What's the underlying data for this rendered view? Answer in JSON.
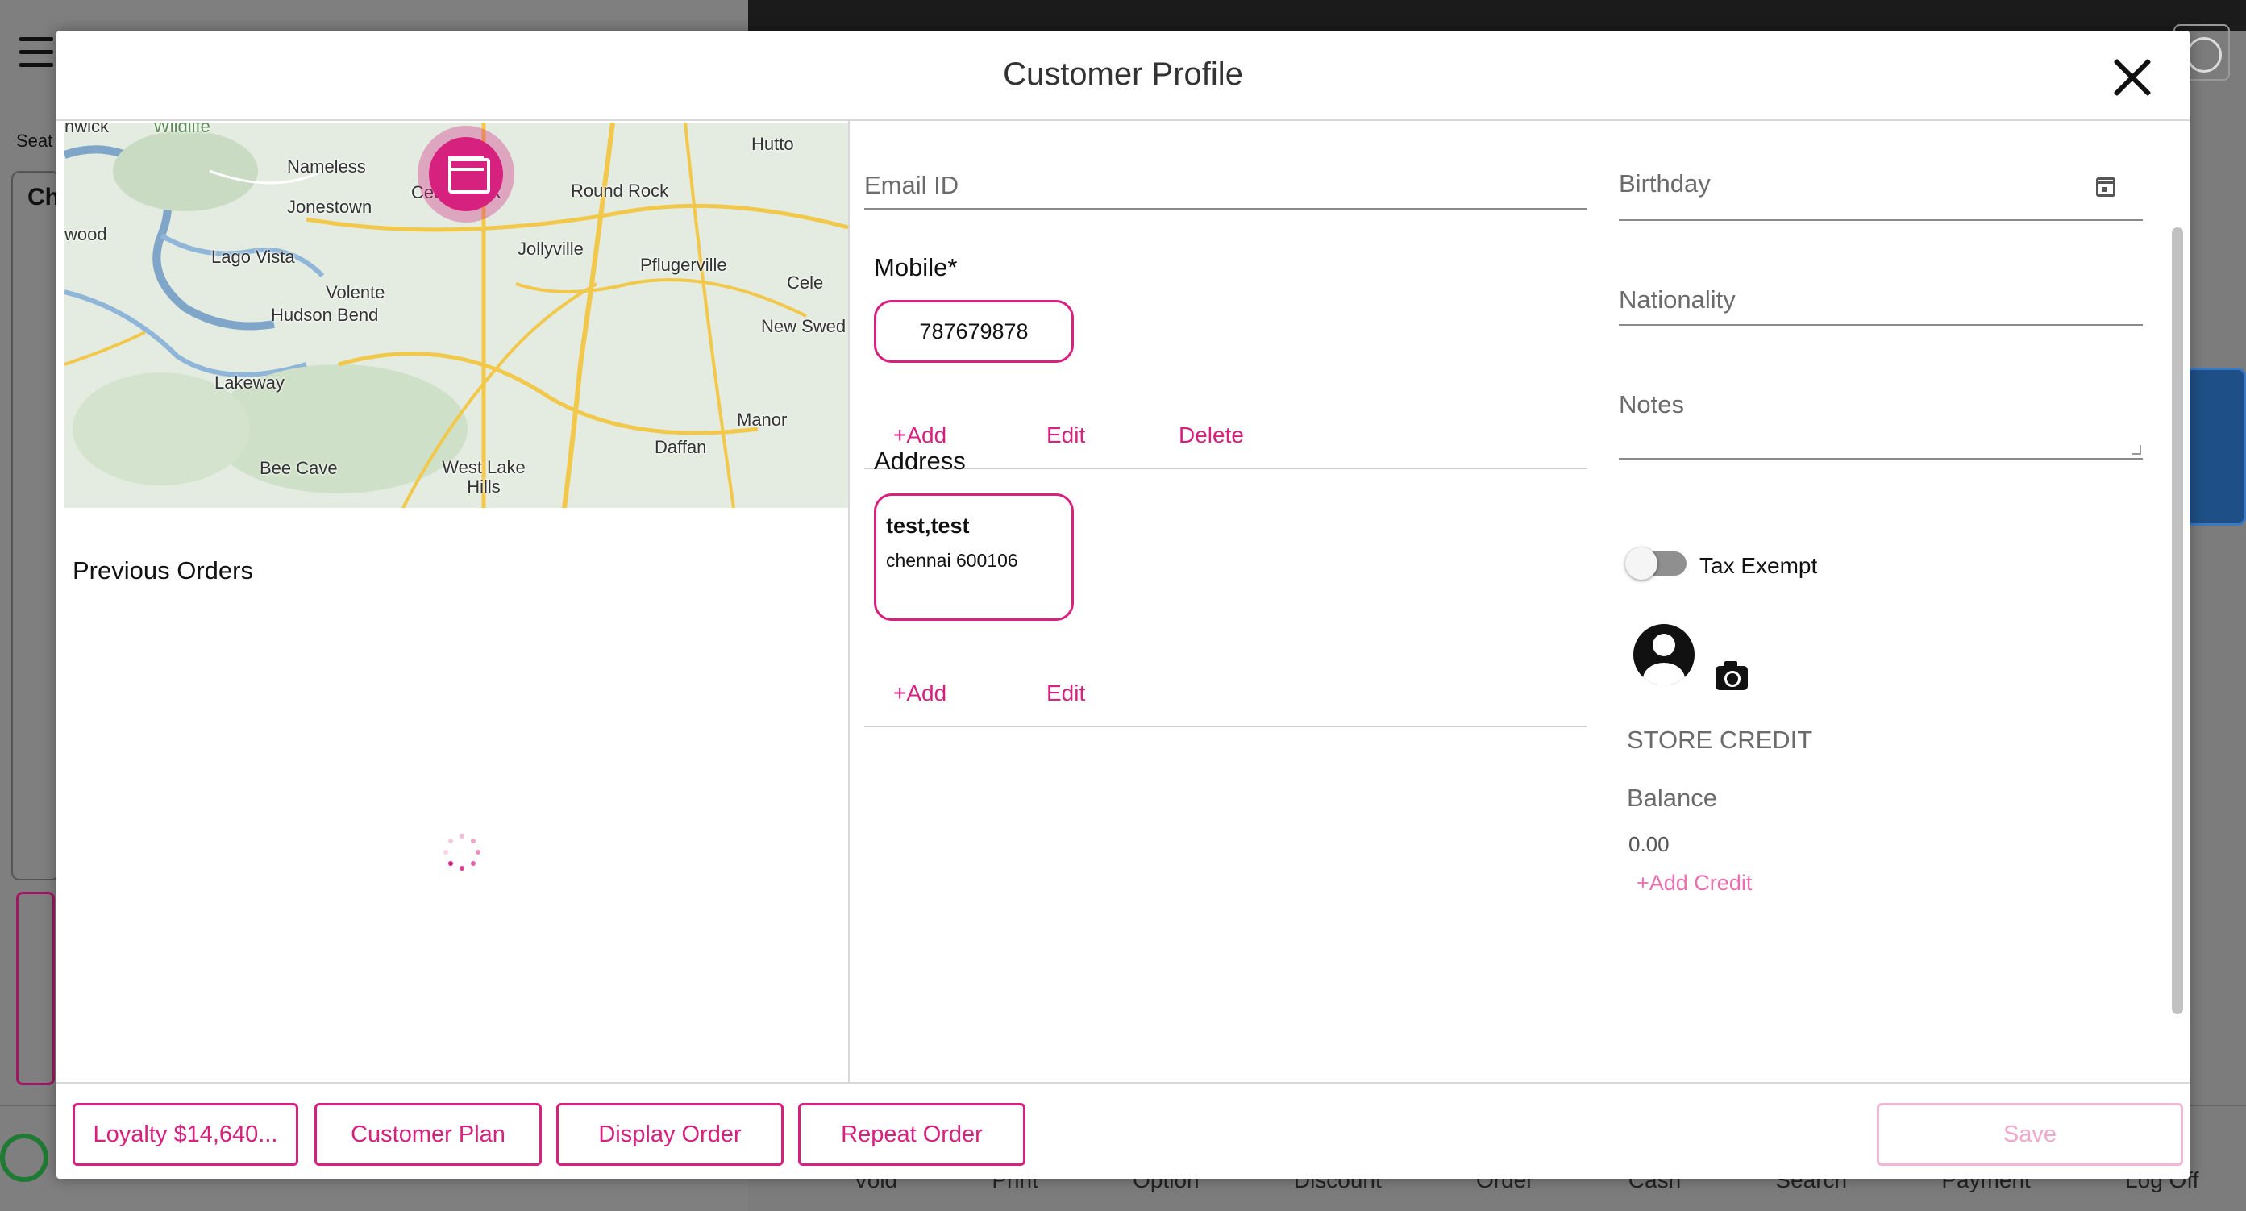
{
  "background": {
    "seat_label": "Seat",
    "panel_label": "Ch",
    "bottom_labels": [
      "Void",
      "Print",
      "Option",
      "Discount",
      "Order",
      "Cash",
      "Search",
      "Payment",
      "Log Off"
    ]
  },
  "modal": {
    "title": "Customer Profile",
    "close_icon": "close-icon"
  },
  "map": {
    "labels": [
      "Wildlife",
      "Nameless",
      "Hutto",
      "Jonestown",
      "Round Rock",
      "Lago Vista",
      "Jollyville",
      "Pflugerville",
      "Cele",
      "Volente",
      "Hudson Bend",
      "New Swed",
      "Lakeway",
      "Manor",
      "Daffan",
      "Bee Cave",
      "West Lake Hills",
      "wood",
      "nwick",
      "Cedar Park"
    ],
    "pin_icon": "store-icon"
  },
  "previous_orders": {
    "title": "Previous Orders",
    "loading": true
  },
  "contact": {
    "email_label": "Email ID",
    "mobile_title": "Mobile*",
    "mobile_value": "787679878",
    "mobile_actions": {
      "add": "+Add",
      "edit": "Edit",
      "delete": "Delete"
    },
    "address_title": "Address",
    "address_name": "test,test",
    "address_city": "chennai 600106",
    "address_actions": {
      "add": "+Add",
      "edit": "Edit"
    }
  },
  "profile": {
    "birthday_label": "Birthday",
    "nationality_label": "Nationality",
    "notes_label": "Notes",
    "tax_exempt_label": "Tax Exempt",
    "tax_exempt_on": false,
    "store_credit_title": "STORE CREDIT",
    "balance_label": "Balance",
    "balance_value": "0.00",
    "add_credit_label": "+Add Credit"
  },
  "footer": {
    "loyalty": "Loyalty $14,640...",
    "customer_plan": "Customer Plan",
    "display_order": "Display Order",
    "repeat_order": "Repeat Order",
    "save": "Save"
  },
  "colors": {
    "accent": "#d6217e",
    "accent_disabled": "#f0a8cc",
    "label_gray": "#6b6b6b"
  }
}
